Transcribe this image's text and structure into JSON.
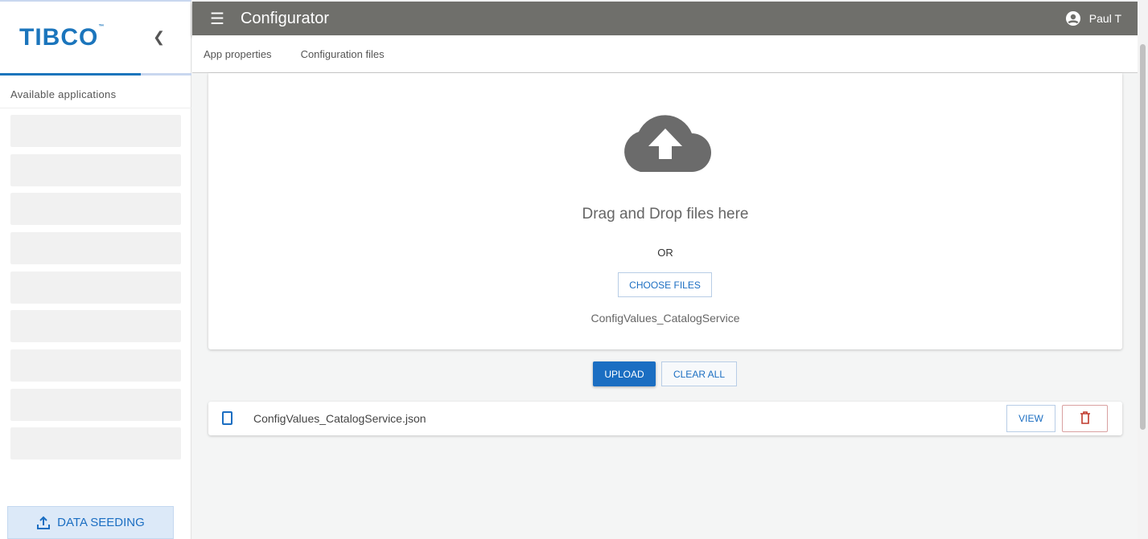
{
  "sidebar": {
    "logo": "TIBCO",
    "section_title": "Available applications",
    "data_seeding": "DATA SEEDING"
  },
  "header": {
    "title": "Configurator",
    "user": "Paul T"
  },
  "tabs": [
    "App properties",
    "Configuration files"
  ],
  "dropzone": {
    "text": "Drag and Drop files here",
    "or": "OR",
    "choose": "CHOOSE FILES",
    "selected": "ConfigValues_CatalogService"
  },
  "actions": {
    "upload": "UPLOAD",
    "clear": "CLEAR ALL"
  },
  "files": [
    {
      "name": "ConfigValues_CatalogService.json",
      "view": "VIEW"
    }
  ]
}
